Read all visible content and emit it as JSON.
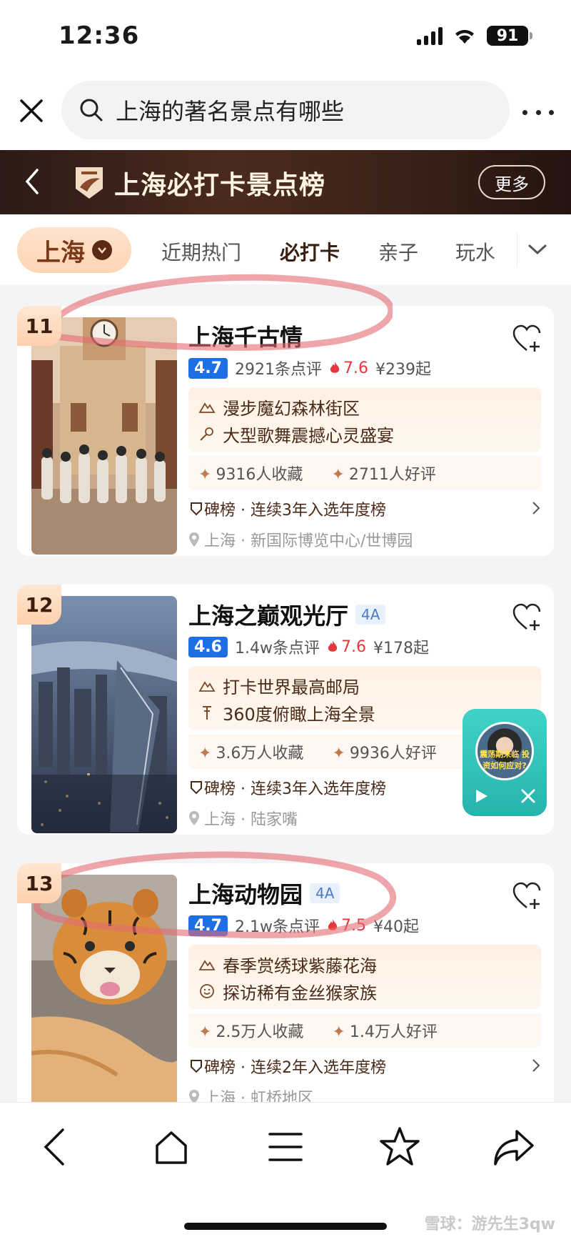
{
  "status_bar": {
    "time": "12:36",
    "battery": "91"
  },
  "search": {
    "query": "上海的著名景点有哪些"
  },
  "banner": {
    "title": "上海必打卡景点榜",
    "more_label": "更多"
  },
  "filters": {
    "city": "上海",
    "tabs": [
      "近期热门",
      "必打卡",
      "亲子",
      "玩水"
    ],
    "active_tab": "必打卡"
  },
  "cards": [
    {
      "rank": "11",
      "name": "上海千古情",
      "grade": "",
      "score": "4.7",
      "reviews": "2921条点评",
      "heat": "7.6",
      "price": "¥239起",
      "highlights": [
        "漫步魔幻森林街区",
        "大型歌舞震撼心灵盛宴"
      ],
      "saves": "9316人收藏",
      "good_reviews": "2711人好评",
      "ranking": "碑榜 · 连续3年入选年度榜",
      "location": "上海 · 新国际博览中心/世博园"
    },
    {
      "rank": "12",
      "name": "上海之巅观光厅",
      "grade": "4A",
      "score": "4.6",
      "reviews": "1.4w条点评",
      "heat": "7.6",
      "price": "¥178起",
      "highlights": [
        "打卡世界最高邮局",
        "360度俯瞰上海全景"
      ],
      "saves": "3.6万人收藏",
      "good_reviews": "9936人好评",
      "ranking": "碑榜 · 连续3年入选年度榜",
      "location": "上海 · 陆家嘴"
    },
    {
      "rank": "13",
      "name": "上海动物园",
      "grade": "4A",
      "score": "4.7",
      "reviews": "2.1w条点评",
      "heat": "7.5",
      "price": "¥40起",
      "highlights": [
        "春季赏绣球紫藤花海",
        "探访稀有金丝猴家族"
      ],
      "saves": "2.5万人收藏",
      "good_reviews": "1.4万人好评",
      "ranking": "碑榜 · 连续2年入选年度榜",
      "location": "上海 · 虹桥地区"
    }
  ],
  "floating_video": {
    "caption": "震荡期来临 投资如何应对?"
  },
  "watermark": "雪球：游先生3qw",
  "colors": {
    "accent_blue": "#1e6fe6",
    "heat_red": "#e4393c",
    "float_teal": "#2fc2ba",
    "banner_dark": "#2b1b16"
  }
}
